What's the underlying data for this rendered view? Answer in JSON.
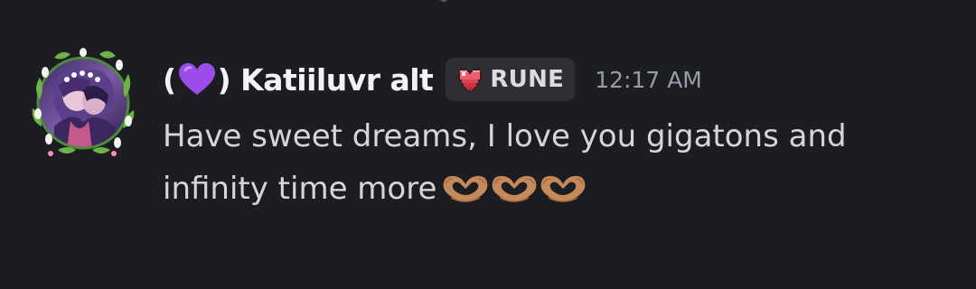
{
  "message": {
    "author": {
      "prefix": "(",
      "heart_emoji": "purple-heart",
      "suffix": ") Katiiluvr alt",
      "name_color": "#f2f3f5"
    },
    "role_tag": {
      "icon": "pixel-heart-icon",
      "label": "RUNE"
    },
    "timestamp": "12:17 AM",
    "text": "Have sweet dreams, I love you gigatons and infinity time more",
    "emojis": [
      "heart-hands",
      "heart-hands",
      "heart-hands"
    ]
  },
  "colors": {
    "background": "#1c1d22",
    "tag_background": "#2e2f35",
    "timestamp": "#9a9ca4",
    "body_text": "#d4d6dc",
    "purple_heart": "#9b4dea",
    "heart_hands": "#c68a5a"
  }
}
